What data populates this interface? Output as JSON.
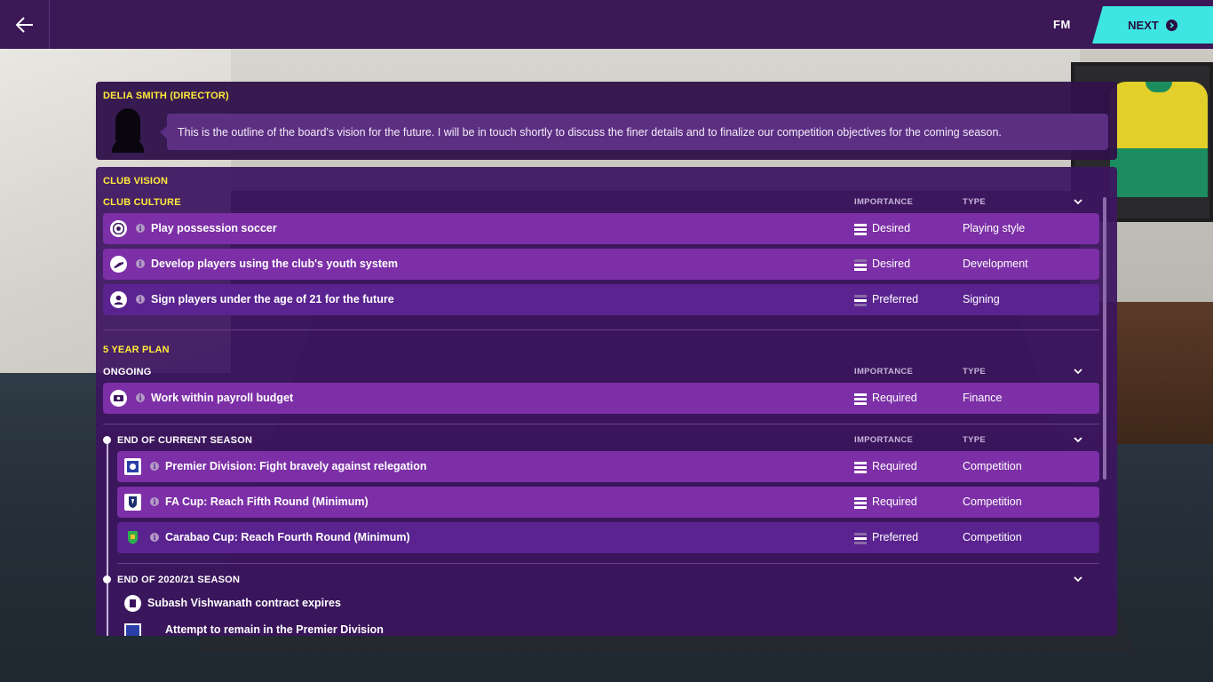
{
  "topbar": {
    "brand": "FM",
    "next_label": "NEXT"
  },
  "director": {
    "name": "DELIA SMITH (DIRECTOR)",
    "message": "This is the outline of the board's vision for the future. I will be in touch shortly to discuss the finer details and to finalize our competition objectives for the coming season."
  },
  "vision": {
    "title": "CLUB VISION",
    "culture": {
      "title": "CLUB CULTURE",
      "col_importance": "IMPORTANCE",
      "col_type": "TYPE",
      "items": [
        {
          "label": "Play possession soccer",
          "importance": "Desired",
          "type": "Playing style",
          "icon": "soccer-ball-icon"
        },
        {
          "label": "Develop players using the club's youth system",
          "importance": "Desired",
          "type": "Development",
          "icon": "youth-boot-icon"
        },
        {
          "label": "Sign players under the age of 21 for the future",
          "importance": "Preferred",
          "type": "Signing",
          "icon": "player-icon"
        }
      ]
    },
    "plan": {
      "title": "5 YEAR PLAN",
      "ongoing": {
        "title": "ONGOING",
        "col_importance": "IMPORTANCE",
        "col_type": "TYPE",
        "items": [
          {
            "label": "Work within payroll budget",
            "importance": "Required",
            "type": "Finance",
            "icon": "money-icon"
          }
        ]
      },
      "current": {
        "title": "END OF CURRENT SEASON",
        "col_importance": "IMPORTANCE",
        "col_type": "TYPE",
        "items": [
          {
            "label": "Premier Division: Fight bravely against relegation",
            "importance": "Required",
            "type": "Competition",
            "icon": "premier-division-icon"
          },
          {
            "label": "FA Cup: Reach Fifth Round (Minimum)",
            "importance": "Required",
            "type": "Competition",
            "icon": "fa-cup-icon"
          },
          {
            "label": "Carabao Cup: Reach Fourth Round (Minimum)",
            "importance": "Preferred",
            "type": "Competition",
            "icon": "carabao-cup-icon"
          }
        ]
      },
      "next": {
        "title": "END OF 2020/21 SEASON",
        "items": [
          {
            "label": "Subash Vishwanath contract expires",
            "icon": "contract-icon"
          },
          {
            "label": "Attempt to remain in the Premier Division",
            "icon": "premier-division-icon"
          }
        ]
      }
    }
  },
  "colors": {
    "accent_yellow": "#ffeb3b",
    "next_button": "#3ee6e3",
    "row_light": "#7c2fa6",
    "row_dark": "#5a2390",
    "panel": "#3c1460"
  }
}
